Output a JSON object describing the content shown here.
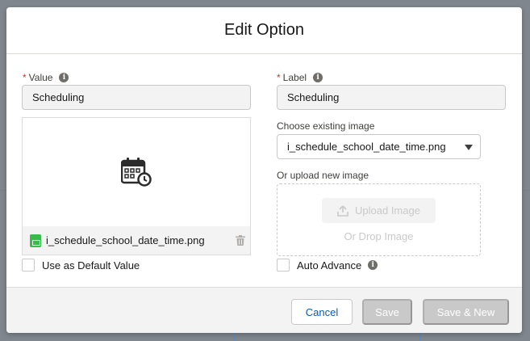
{
  "modal": {
    "title": "Edit Option"
  },
  "value_field": {
    "required_marker": "*",
    "label": "Value",
    "value": "Scheduling",
    "info_icon": "info-icon"
  },
  "label_field": {
    "required_marker": "*",
    "label": "Label",
    "value": "Scheduling",
    "info_icon": "info-icon"
  },
  "image_preview": {
    "icon": "calendar-clock-icon",
    "file_name": "i_schedule_school_date_time.png",
    "file_icon": "image-file-icon",
    "delete_icon": "trash-icon"
  },
  "existing_image": {
    "label": "Choose existing image",
    "selected": "i_schedule_school_date_time.png"
  },
  "upload": {
    "label": "Or upload new image",
    "button_label": "Upload Image",
    "drop_text": "Or Drop Image"
  },
  "options": {
    "default_label": "Use as Default Value",
    "default_checked": false,
    "auto_advance_label": "Auto Advance",
    "auto_advance_checked": false
  },
  "footer": {
    "cancel_label": "Cancel",
    "save_label": "Save",
    "save_new_label": "Save & New"
  },
  "colors": {
    "required": "#c23934",
    "brand_link": "#0b5cab",
    "disabled_button": "#c9c9c9",
    "file_icon": "#3bba4c"
  }
}
